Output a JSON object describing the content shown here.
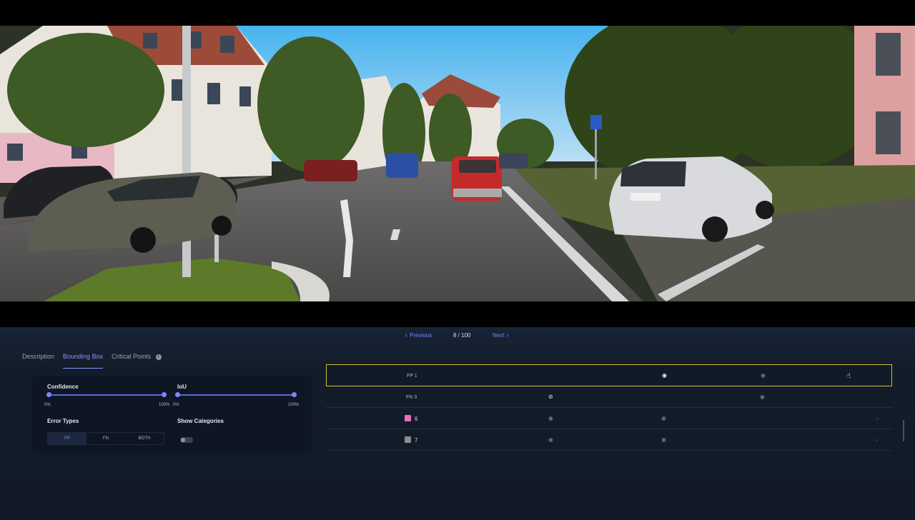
{
  "pager": {
    "prev_label": "Previous",
    "next_label": "Next",
    "page_indicator": "8 / 100"
  },
  "tabs": [
    {
      "label": "Description",
      "active": false
    },
    {
      "label": "Bounding Box",
      "active": true
    },
    {
      "label": "Critical Points",
      "active": false
    }
  ],
  "filters": {
    "confidence": {
      "label": "Confidence",
      "min_label": "0%",
      "max_label": "100%",
      "min": 0,
      "max": 100
    },
    "iou": {
      "label": "IoU",
      "min_label": "0%",
      "max_label": "100%",
      "min": 0,
      "max": 100
    },
    "error_types": {
      "label": "Error Types",
      "options": [
        "FP",
        "FN",
        "BOTH"
      ],
      "selected": "FP"
    },
    "show_categories": {
      "label": "Show Categories",
      "enabled": false
    }
  },
  "results": [
    {
      "type": "error",
      "label": "FP 1",
      "selected": true
    },
    {
      "type": "error",
      "label": "FN 3",
      "selected": false
    },
    {
      "type": "category",
      "id": "6",
      "color": "#e86fb8"
    },
    {
      "type": "category",
      "id": "7",
      "color": "#8c8c8c"
    }
  ],
  "colors": {
    "accent": "#7b86ff",
    "selected_border": "#d8b832",
    "background": "#131c2a"
  }
}
